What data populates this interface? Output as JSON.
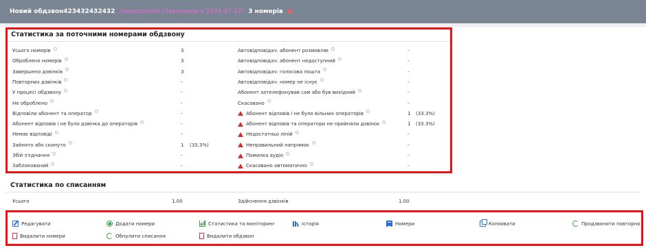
{
  "header": {
    "title": "Новий обдзвон423432432432",
    "status": "Завершений (Завершився 2024-07-22)",
    "count": "3 номерів",
    "warn_icon": "warning-triangle-icon"
  },
  "stats": {
    "title": "Статистика за поточними номерами обдзвону",
    "left": [
      {
        "label": "Усього номерів",
        "value": "3",
        "pct": ""
      },
      {
        "label": "Оброблено номерів",
        "value": "3",
        "pct": ""
      },
      {
        "label": "Завершено дзвінків",
        "value": "3",
        "pct": ""
      },
      {
        "label": "Повторних дзвінків",
        "value": "-",
        "pct": ""
      },
      {
        "label": "У процесі обдзвону",
        "value": "-",
        "pct": ""
      },
      {
        "label": "Не оброблено",
        "value": "-",
        "pct": ""
      },
      {
        "label": "Відповіли абонент та оператор",
        "value": "-",
        "pct": ""
      },
      {
        "label": "Абонент відповів і не було дзвінка до операторів",
        "value": "-",
        "pct": ""
      },
      {
        "label": "Немає відповіді",
        "value": "-",
        "pct": ""
      },
      {
        "label": "Зайнято або скинуто",
        "value": "1",
        "pct": "(33.3%)"
      },
      {
        "label": "Збій з'єднання",
        "value": "-",
        "pct": ""
      },
      {
        "label": "Заблокований",
        "value": "-",
        "pct": ""
      }
    ],
    "right": [
      {
        "label": "Автовідповідач: абонент розмовляє",
        "value": "-",
        "pct": "",
        "warn": false
      },
      {
        "label": "Автовідповідач: абонент недоступний",
        "value": "-",
        "pct": "",
        "warn": false
      },
      {
        "label": "Автовідповідач: голосова пошта",
        "value": "-",
        "pct": "",
        "warn": false
      },
      {
        "label": "Автовідповідач: номер не існує",
        "value": "-",
        "pct": "",
        "warn": false
      },
      {
        "label": "Абонент зателефонував сам або був вихідний",
        "value": "-",
        "pct": "",
        "warn": false
      },
      {
        "label": "Скасовано",
        "value": "-",
        "pct": "",
        "warn": false
      },
      {
        "label": "Абонент відповів і не було вільних операторів",
        "value": "1",
        "pct": "(33.3%)",
        "warn": true
      },
      {
        "label": "Абонент відповів та оператори не прийняли дзвінок",
        "value": "1",
        "pct": "(33.3%)",
        "warn": true
      },
      {
        "label": "Недостатньо ліній",
        "value": "-",
        "pct": "",
        "warn": true
      },
      {
        "label": "Неправильний напрямок",
        "value": "-",
        "pct": "",
        "warn": true
      },
      {
        "label": "Помилка аудіо",
        "value": "-",
        "pct": "",
        "warn": true
      },
      {
        "label": "Скасовано автоматично",
        "value": "-",
        "pct": "",
        "warn": true
      }
    ]
  },
  "charges": {
    "title": "Статистика по списанням",
    "total_label": "Усього",
    "total_value": "1.00",
    "calls_label": "Здійснення дзвінків",
    "calls_value": "1.00"
  },
  "actions": [
    {
      "label": "Редагувати",
      "icon": "edit-icon"
    },
    {
      "label": "Додати номери",
      "icon": "add-circle-icon"
    },
    {
      "label": "Статистика та моніторинг",
      "icon": "bar-chart-icon"
    },
    {
      "label": "Історія",
      "icon": "history-icon"
    },
    {
      "label": "Номери",
      "icon": "list-icon"
    },
    {
      "label": "Копіювати",
      "icon": "copy-icon"
    },
    {
      "label": "Продзвонити повторно",
      "icon": "refresh-icon"
    },
    {
      "label": "Видалити номери",
      "icon": "trash-icon"
    },
    {
      "label": "Обнулити списання",
      "icon": "refresh-icon"
    },
    {
      "label": "Видалити обдзвон",
      "icon": "trash-icon"
    }
  ],
  "colors": {
    "header_bg": "#7a8593",
    "status": "#e86bd6",
    "highlight": "#ee1111",
    "warn": "#d92b2b",
    "blue": "#2b6fd6",
    "green": "#2ea043"
  }
}
